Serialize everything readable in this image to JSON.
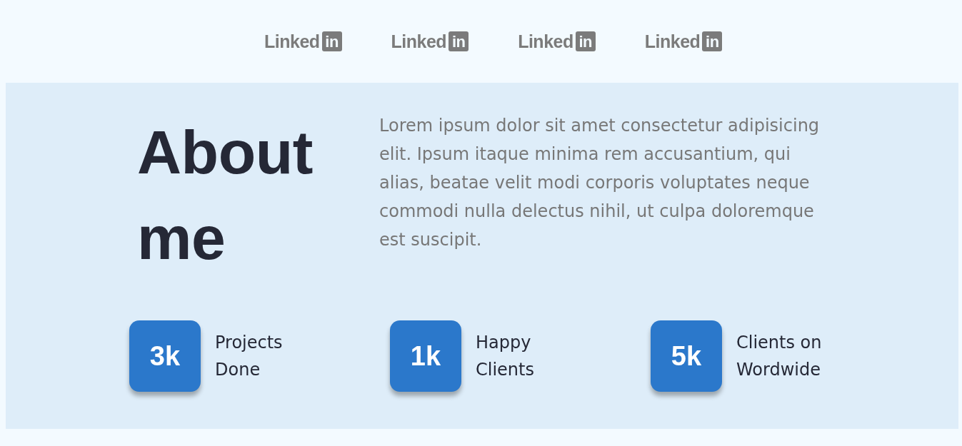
{
  "logos": [
    {
      "wordmark": "Linked",
      "badge": "in"
    },
    {
      "wordmark": "Linked",
      "badge": "in"
    },
    {
      "wordmark": "Linked",
      "badge": "in"
    },
    {
      "wordmark": "Linked",
      "badge": "in"
    }
  ],
  "about": {
    "heading": "About me",
    "text": "Lorem ipsum dolor sit amet consectetur adipisicing elit. Ipsum itaque minima rem accusantium, qui alias, beatae velit modi corporis voluptates neque commodi nulla delectus nihil, ut culpa doloremque est suscipit."
  },
  "stats": [
    {
      "value": "3k",
      "label": "Projects Done"
    },
    {
      "value": "1k",
      "label": "Happy Clients"
    },
    {
      "value": "5k",
      "label": "Clients on Wordwide"
    }
  ]
}
